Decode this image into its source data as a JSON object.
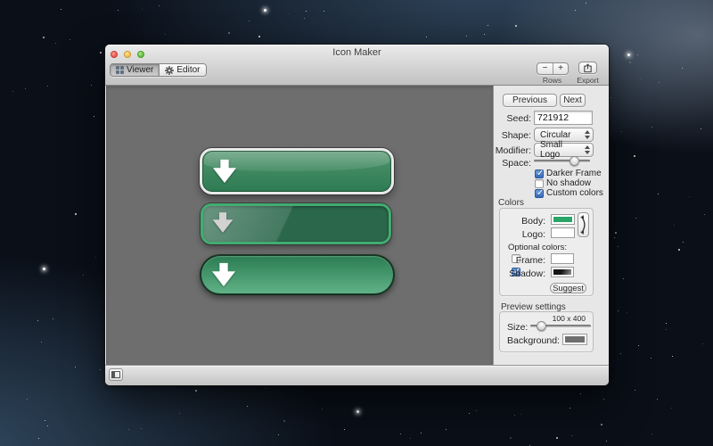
{
  "window": {
    "title": "Icon Maker",
    "toolbar": {
      "viewer_tab": "Viewer",
      "editor_tab": "Editor",
      "minus": "−",
      "plus": "+",
      "rows_label": "Rows",
      "export_label": "Export"
    },
    "viewer": {
      "background_color": "#6e6e6e",
      "buttons": [
        {
          "icon": "down-arrow-icon",
          "frame_style": "silver frame",
          "body_color": "#35855c",
          "arrow_color": "#ffffff"
        },
        {
          "icon": "down-arrow-icon",
          "frame_style": "green frame dark body",
          "body_color": "#2b674a",
          "arrow_color": "#d2d2d2"
        },
        {
          "icon": "down-arrow-icon",
          "frame_style": "dark pill gradient",
          "body_color": "#459a6e",
          "arrow_color": "#ffffff"
        }
      ]
    },
    "sidebar": {
      "previous_label": "Previous",
      "next_label": "Next",
      "seed_label": "Seed:",
      "seed_value": "721912",
      "shape_label": "Shape:",
      "shape_value": "Circular",
      "modifier_label": "Modifier:",
      "modifier_value": "Small Logo",
      "space_label": "Space:",
      "space_thumb_left": "72%",
      "checkboxes": [
        {
          "label": "Darker Frame",
          "checked": true
        },
        {
          "label": "No shadow",
          "checked": false
        },
        {
          "label": "Custom colors",
          "checked": true
        }
      ],
      "colors": {
        "title": "Colors",
        "body_label": "Body:",
        "body_color": "#29a566",
        "logo_label": "Logo:",
        "logo_color": "#ffffff",
        "swap_icon": "swap-arrow-icon",
        "optional_label": "Optional colors:",
        "frame_label": "Frame:",
        "frame_checked": false,
        "frame_color": "#ffffff",
        "shadow_label": "Shadow:",
        "shadow_checked": true,
        "shadow_color": "#141414",
        "suggest_label": "Suggest"
      },
      "preview": {
        "title": "Preview settings",
        "size_readout": "100 x 400",
        "size_label": "Size:",
        "size_thumb_left": "18%",
        "background_label": "Background:",
        "background_color": "#6e6e6e"
      }
    }
  }
}
